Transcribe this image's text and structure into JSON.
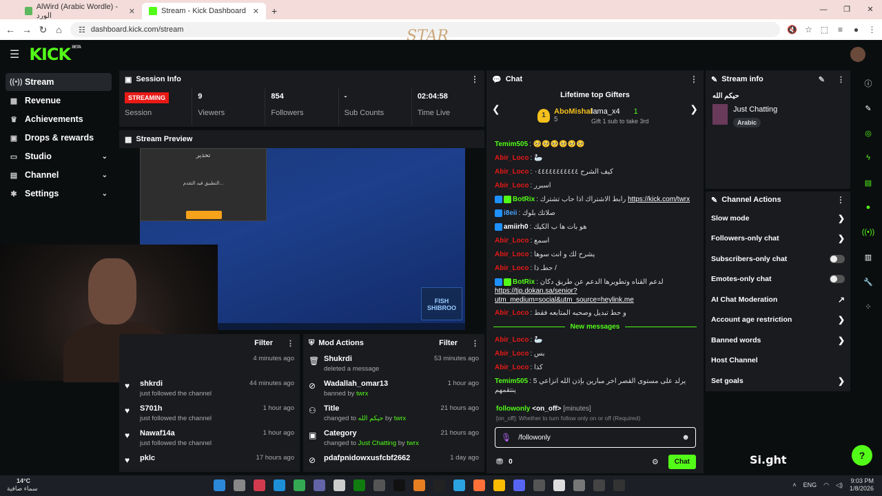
{
  "browser": {
    "tabs": [
      {
        "title": "AlWird (Arabic Wordle) - الورد",
        "active": false,
        "color": "#5cb85c"
      },
      {
        "title": "Stream - Kick Dashboard",
        "active": true,
        "color": "#53fc18"
      }
    ],
    "url": "dashboard.kick.com/stream"
  },
  "watermark": "STAR",
  "header": {
    "logo": "KICK",
    "beta": "BETA"
  },
  "sidebar": {
    "items": [
      {
        "label": "Stream",
        "icon": "broadcast-icon",
        "glyph": "((•))",
        "active": true,
        "chevron": false
      },
      {
        "label": "Revenue",
        "icon": "revenue-icon",
        "glyph": "▦",
        "active": false,
        "chevron": false
      },
      {
        "label": "Achievements",
        "icon": "trophy-icon",
        "glyph": "♛",
        "active": false,
        "chevron": false
      },
      {
        "label": "Drops & rewards",
        "icon": "gift-icon",
        "glyph": "▣",
        "active": false,
        "chevron": false
      },
      {
        "label": "Studio",
        "icon": "studio-icon",
        "glyph": "▭",
        "active": false,
        "chevron": true
      },
      {
        "label": "Channel",
        "icon": "channel-icon",
        "glyph": "▤",
        "active": false,
        "chevron": true
      },
      {
        "label": "Settings",
        "icon": "gear-icon",
        "glyph": "✱",
        "active": false,
        "chevron": true
      }
    ]
  },
  "session": {
    "title": "Session Info",
    "streaming": "STREAMING",
    "stats": [
      {
        "value": "",
        "label": "Session"
      },
      {
        "value": "9",
        "label": "Viewers"
      },
      {
        "value": "854",
        "label": "Followers"
      },
      {
        "value": "-",
        "label": "Sub Counts"
      },
      {
        "value": "02:04:58",
        "label": "Time Live"
      }
    ]
  },
  "preview": {
    "title": "Stream Preview",
    "dialog_title": "تحذير",
    "dialog_msg": "التطبيق قيد التقدم...",
    "tag": "FISH SHIBROO"
  },
  "feed": {
    "filter": "Filter",
    "rows": [
      {
        "who": "",
        "what": "",
        "when": "4 minutes ago"
      },
      {
        "who": "shkrdi",
        "what": "just followed the channel",
        "when": "44 minutes ago"
      },
      {
        "who": "S701h",
        "what": "just followed the channel",
        "when": "1 hour ago"
      },
      {
        "who": "Nawaf14a",
        "what": "just followed the channel",
        "when": "1 hour ago"
      },
      {
        "who": "pklc",
        "what": "",
        "when": "17 hours ago"
      }
    ]
  },
  "mod": {
    "title": "Mod Actions",
    "filter": "Filter",
    "rows": [
      {
        "icon": "trash-icon",
        "glyph": "🗑",
        "who": "Shukrdi",
        "what": "deleted a message",
        "extra": "",
        "by": "",
        "when": "53 minutes ago"
      },
      {
        "icon": "ban-icon",
        "glyph": "⊘",
        "who": "Wadallah_omar13",
        "what": "banned by",
        "extra": "",
        "by": "twrx",
        "when": "1 hour ago"
      },
      {
        "icon": "user-edit-icon",
        "glyph": "⚇",
        "who": "Title",
        "what": "changed to",
        "extra": "حيكم الله",
        "by": "twrx",
        "when": "21 hours ago"
      },
      {
        "icon": "category-icon",
        "glyph": "▣",
        "who": "Category",
        "what": "changed to",
        "extra": "Just Chatting",
        "by": "twrx",
        "when": "21 hours ago"
      },
      {
        "icon": "ban-icon",
        "glyph": "⊘",
        "who": "pdafpnidowxusfcbf2662",
        "what": "",
        "extra": "",
        "by": "",
        "when": "1 day ago"
      }
    ]
  },
  "chat": {
    "title": "Chat",
    "gifters_title": "Lifetime top Gifters",
    "gifter1": {
      "rank": "1",
      "name": "AboMishal",
      "count": "5"
    },
    "gifter2": {
      "name": "lama_x4",
      "count": "1",
      "gift": "Gift 1 sub to take 3rd"
    },
    "messages": [
      {
        "user": "Temim505",
        "color": "#53fc18",
        "badges": [],
        "text": "🥺🥺🥺🥺🥺🥺",
        "link": ""
      },
      {
        "user": "Abir_Loco",
        "color": "#e91916",
        "badges": [],
        "text": "🦢",
        "link": ""
      },
      {
        "user": "Abir_Loco",
        "color": "#e91916",
        "badges": [],
        "text": "كيف الشرح ٠٤٤٤٤٤٤٤٤٤٤٤",
        "link": ""
      },
      {
        "user": "Abir_Loco",
        "color": "#e91916",
        "badges": [],
        "text": "اسبرر",
        "link": ""
      },
      {
        "user": "BotRix",
        "color": "#53fc18",
        "badges": [
          "#1e90ff",
          "#53fc18"
        ],
        "text": "رابط الاشتراك اذا حاب تشترك",
        "link": "https://kick.com/twrx"
      },
      {
        "user": "i8eii",
        "color": "#4aa3ff",
        "badges": [
          "#1e90ff"
        ],
        "text": "صلاتك بلوك",
        "link": ""
      },
      {
        "user": "amiirh0",
        "color": "#fff",
        "badges": [
          "#1e90ff"
        ],
        "text": "هو بات ها ب الكيك",
        "link": ""
      },
      {
        "user": "Abir_Loco",
        "color": "#e91916",
        "badges": [],
        "text": "اسمع",
        "link": ""
      },
      {
        "user": "Abir_Loco",
        "color": "#e91916",
        "badges": [],
        "text": "يشرح لك و انت سوها",
        "link": ""
      },
      {
        "user": "Abir_Loco",
        "color": "#e91916",
        "badges": [],
        "text": "حطـ ذا /",
        "link": ""
      },
      {
        "user": "BotRix",
        "color": "#53fc18",
        "badges": [
          "#1e90ff",
          "#53fc18"
        ],
        "text": "لدعم القناه وتطويرها الدعم عن طريق دكان",
        "link": "https://tip.dokan.sa/senior?utm_medium=social&utm_source=heylink.me"
      },
      {
        "user": "Abir_Loco",
        "color": "#e91916",
        "badges": [],
        "text": "و حط تبديل وصحبه المتابعه فقط",
        "link": ""
      }
    ],
    "new_messages": "New messages",
    "messages_new": [
      {
        "user": "Abir_Loco",
        "color": "#e91916",
        "badges": [],
        "text": "🦢",
        "link": ""
      },
      {
        "user": "Abir_Loco",
        "color": "#e91916",
        "badges": [],
        "text": "بس",
        "link": ""
      },
      {
        "user": "Abir_Loco",
        "color": "#e91916",
        "badges": [],
        "text": "كذا",
        "link": ""
      },
      {
        "user": "Temim505",
        "color": "#53fc18",
        "badges": [],
        "text": "5 يرلد على مستوى القصر اخر مبارين بإذن الله انزاعي ينتقمهم",
        "link": ""
      }
    ],
    "cmd": {
      "name": "followonly",
      "arg": "<on_off>",
      "opt": "[minutes]",
      "desc": "[on_off]: Whether to turn follow only on or off (Required)"
    },
    "input_value": "/followonly ",
    "points": "0",
    "send": "Chat"
  },
  "stream_info": {
    "title": "Stream info",
    "stream_title": "حيكم الله",
    "category": "Just Chatting",
    "language": "Arabic"
  },
  "channel_actions": {
    "title": "Channel Actions",
    "rows": [
      {
        "label": "Slow mode",
        "kind": "arrow"
      },
      {
        "label": "Followers-only chat",
        "kind": "arrow"
      },
      {
        "label": "Subscribers-only chat",
        "kind": "toggle"
      },
      {
        "label": "Emotes-only chat",
        "kind": "toggle"
      },
      {
        "label": "AI Chat Moderation",
        "kind": "ext"
      },
      {
        "label": "Account age restriction",
        "kind": "arrow"
      },
      {
        "label": "Banned words",
        "kind": "arrow"
      },
      {
        "label": "Host Channel",
        "kind": "none"
      },
      {
        "label": "Set goals",
        "kind": "arrow"
      }
    ]
  },
  "overlay": {
    "sight": "Si.ght"
  },
  "taskbar": {
    "temp": "14°C",
    "weather": "سماء صافية",
    "lang": "ENG",
    "time": "9:03 PM",
    "date": "1/8/2026"
  }
}
